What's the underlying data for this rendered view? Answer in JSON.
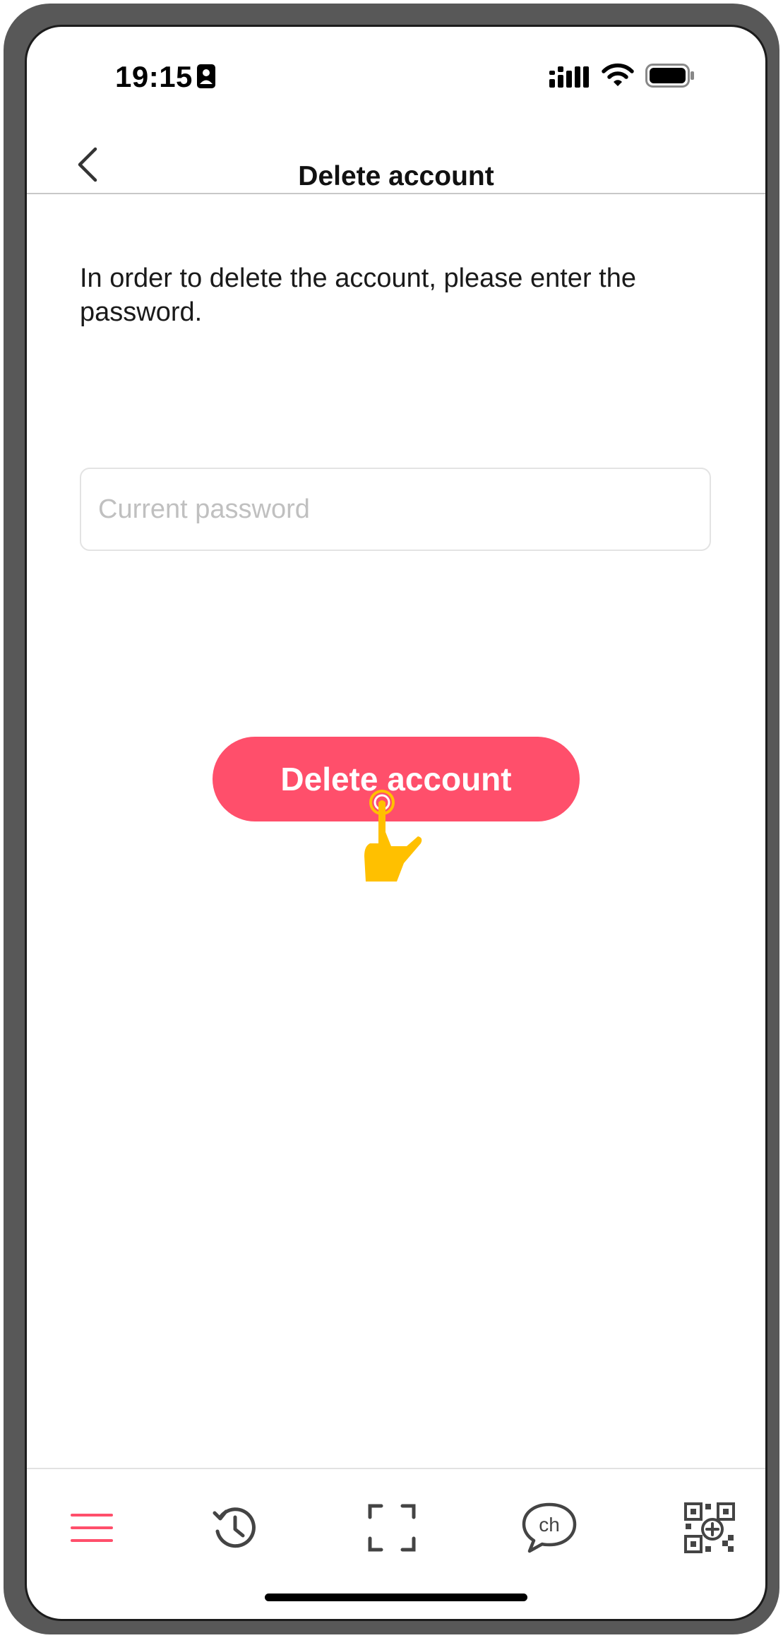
{
  "status_bar": {
    "time": "19:15",
    "icons": [
      "person-card-icon",
      "signal-icon",
      "wifi-icon",
      "battery-icon"
    ]
  },
  "header": {
    "title": "Delete account",
    "back_icon": "chevron-left-icon"
  },
  "content": {
    "instruction": "In order to delete the account, please enter the password.",
    "password_placeholder": "Current password",
    "password_value": "",
    "delete_button_label": "Delete account"
  },
  "bottom_nav": {
    "items": [
      {
        "icon": "menu-icon",
        "active": true
      },
      {
        "icon": "history-icon",
        "active": false
      },
      {
        "icon": "scan-frame-icon",
        "active": false
      },
      {
        "icon": "chat-ch-icon",
        "label": "ch",
        "active": false
      },
      {
        "icon": "qr-add-icon",
        "active": false
      }
    ]
  },
  "colors": {
    "accent": "#ff4f6b",
    "nav_active": "#ff4f6b",
    "nav_inactive": "#444444",
    "hand": "#ffc000"
  }
}
